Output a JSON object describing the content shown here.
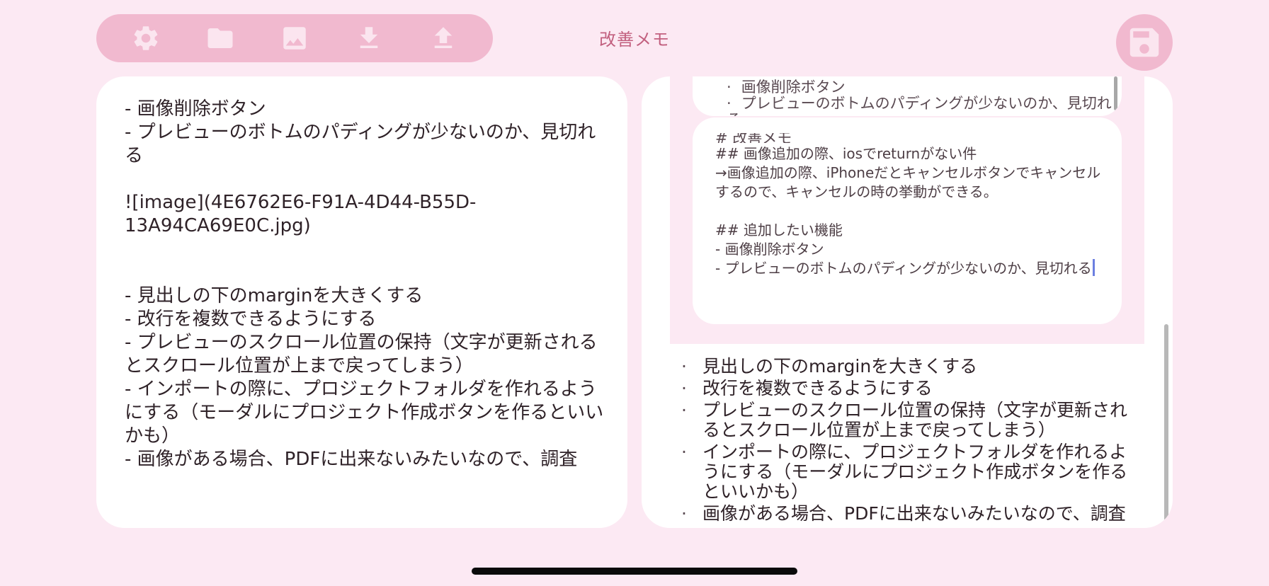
{
  "app": {
    "title": "改善メモ"
  },
  "toolbar": {
    "buttons": [
      {
        "name": "settings",
        "icon": "gear-icon"
      },
      {
        "name": "folder",
        "icon": "folder-icon"
      },
      {
        "name": "image",
        "icon": "image-icon"
      },
      {
        "name": "download",
        "icon": "download-icon"
      },
      {
        "name": "upload",
        "icon": "upload-icon"
      }
    ],
    "save_icon": "floppy-disk-icon"
  },
  "editor": {
    "content": "- 画像削除ボタン\n- プレビューのボトムのパディングが少ないのか、見切れる\n\n![image](4E6762E6-F91A-4D44-B55D-13A94CA69E0C.jpg)\n\n\n- 見出しの下のmarginを大きくする\n- 改行を複数できるようにする\n- プレビューのスクロール位置の保持（文字が更新されるとスクロール位置が上まで戻ってしまう）\n- インポートの際に、プロジェクトフォルダを作れるようにする（モーダルにプロジェクト作成ボタンを作るといいかも）\n- 画像がある場合、PDFに出来ないみたいなので、調査"
  },
  "preview": {
    "top_card_items": [
      "画像削除ボタン",
      "プレビューのボトムのパディングが少ないのか、見切れる"
    ],
    "embedded_cut_line": "# 改善メモ",
    "embedded_text": "## 画像追加の際、iosでreturnがない件\n→画像追加の際、iPhoneだとキャンセルボタンでキャンセルするので、キャンセルの時の挙動ができる。\n\n## 追加したい機能\n- 画像削除ボタン\n- プレビューのボトムのパディングが少ないのか、見切れる",
    "list_items": [
      "見出しの下のmarginを大きくする",
      "改行を複数できるようにする",
      "プレビューのスクロール位置の保持（文字が更新されるとスクロール位置が上まで戻ってしまう）",
      "インポートの際に、プロジェクトフォルダを作れるようにする（モーダルにプロジェクト作成ボタンを作るといいかも）",
      "画像がある場合、PDFに出来ないみたいなので、調査"
    ]
  },
  "colors": {
    "background": "#fce9f3",
    "accent": "#f1b9cf",
    "icon": "#fbe5ef",
    "title": "#c2607f",
    "caret": "#6c7fe0"
  }
}
